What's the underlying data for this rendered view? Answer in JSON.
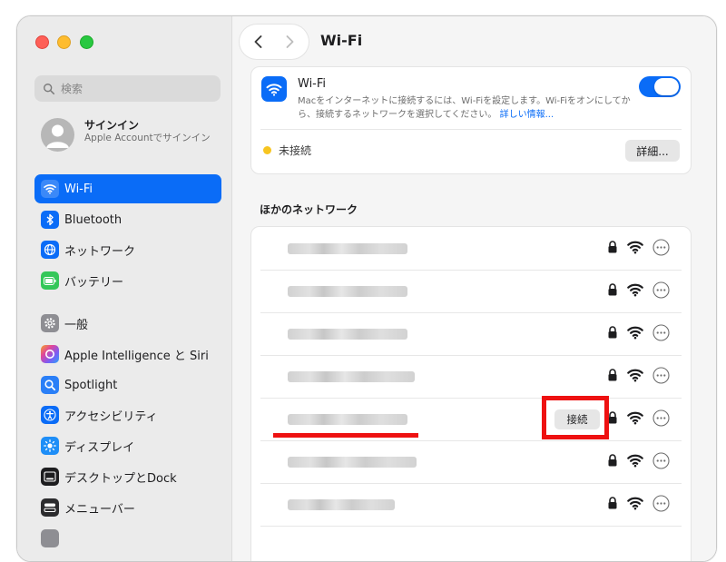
{
  "window": {
    "title": "Wi-Fi"
  },
  "sidebar": {
    "search_placeholder": "検索",
    "account": {
      "title": "サインイン",
      "subtitle": "Apple Accountでサインイン"
    },
    "items": [
      {
        "label": "Wi-Fi",
        "icon": "wifi-icon",
        "color": "#0a6cf7",
        "active": true
      },
      {
        "label": "Bluetooth",
        "icon": "bluetooth-icon",
        "color": "#0a6cf7"
      },
      {
        "label": "ネットワーク",
        "icon": "globe-icon",
        "color": "#0a6cf7"
      },
      {
        "label": "バッテリー",
        "icon": "battery-icon",
        "color": "#34c759"
      },
      {
        "label": "一般",
        "icon": "gear-icon",
        "color": "#8e8e93"
      },
      {
        "label": "Apple Intelligence と Siri",
        "icon": "siri-icon",
        "color": "#c955e0"
      },
      {
        "label": "Spotlight",
        "icon": "magnifier-icon",
        "color": "#2a7ff7"
      },
      {
        "label": "アクセシビリティ",
        "icon": "accessibility-icon",
        "color": "#0a6cf7"
      },
      {
        "label": "ディスプレイ",
        "icon": "sun-icon",
        "color": "#1e8ef7"
      },
      {
        "label": "デスクトップとDock",
        "icon": "dock-icon",
        "color": "#1d1d1f"
      },
      {
        "label": "メニューバー",
        "icon": "menubar-icon",
        "color": "#2c2c2e"
      }
    ]
  },
  "wifi": {
    "name": "Wi-Fi",
    "description": "Macをインターネットに接続するには、Wi-Fiを設定します。Wi-Fiをオンにしてから、接続するネットワークを選択してください。",
    "link": "詳しい情報...",
    "enabled": true,
    "status": "未接続",
    "details_label": "詳細..."
  },
  "other_networks": {
    "title": "ほかのネットワーク",
    "connect_label": "接続",
    "rows": [
      {
        "locked": true
      },
      {
        "locked": true
      },
      {
        "locked": true
      },
      {
        "locked": true
      },
      {
        "locked": true,
        "hovered": true
      },
      {
        "locked": true
      },
      {
        "locked": true
      }
    ]
  },
  "accent": "#0a6cf7"
}
